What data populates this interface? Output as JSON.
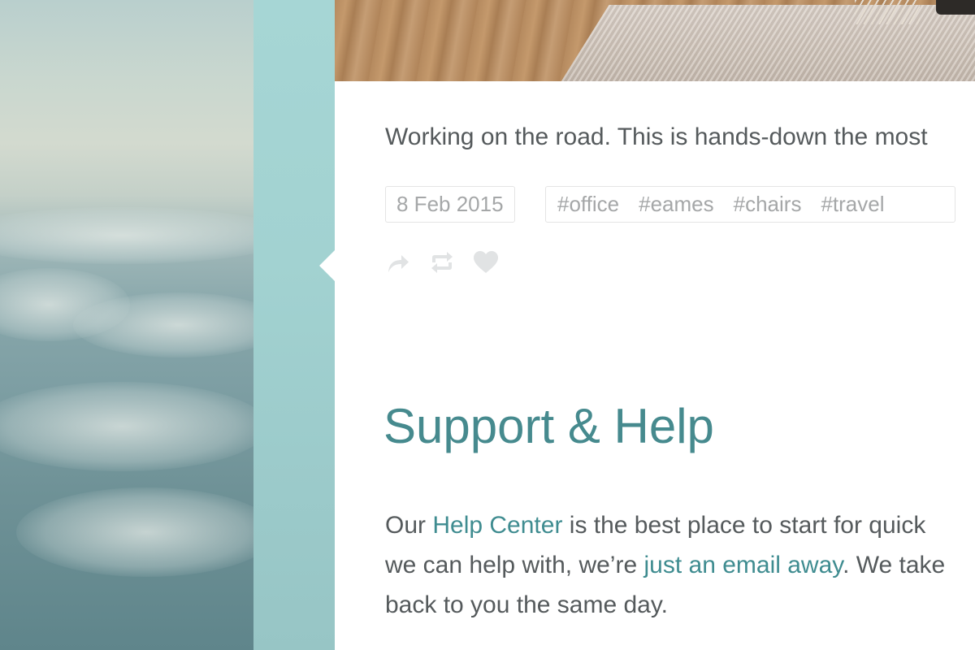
{
  "post": {
    "text": "Working on the road. This is hands-down the most",
    "date": "8 Feb 2015",
    "tags": [
      "#office",
      "#eames",
      "#chairs",
      "#travel"
    ],
    "actions": [
      {
        "name": "share-icon"
      },
      {
        "name": "repost-icon"
      },
      {
        "name": "like-icon"
      }
    ]
  },
  "support": {
    "heading": "Support & Help",
    "line1_prefix": "Our ",
    "help_center_link": "Help Center",
    "line1_suffix": " is the best place to start for quick",
    "line2_prefix": "we can help with, we’re ",
    "email_link": "just an email away",
    "line2_suffix": ". We take",
    "line3": "back to you the same day."
  },
  "colors": {
    "accent": "#468a8e",
    "text": "#555a5c",
    "muted": "#a5a7a8",
    "strip": "#a2d2d1"
  }
}
